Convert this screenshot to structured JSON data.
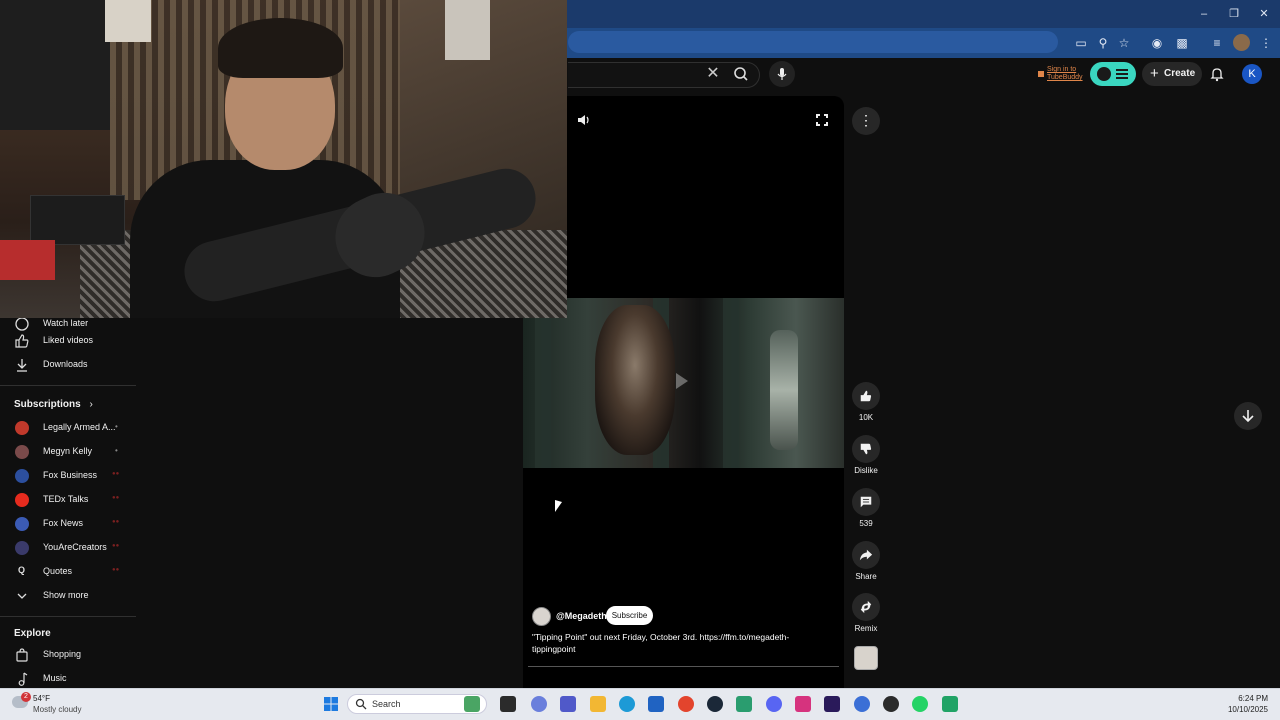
{
  "header": {
    "tubebuddy_label": "Sign in to TubeBuddy",
    "create_label": "Create",
    "avatar_letter": "K"
  },
  "sidebar": {
    "partial_item": "Watch later",
    "items": [
      {
        "label": "Liked videos",
        "icon": "thumbs-up-icon"
      },
      {
        "label": "Downloads",
        "icon": "download-icon"
      }
    ],
    "subscriptions_heading": "Subscriptions",
    "subscriptions": [
      {
        "label": "Legally Armed A...",
        "color": "#c0392b",
        "indicator": "dot"
      },
      {
        "label": "Megyn Kelly",
        "color": "#7a4a4a",
        "indicator": "dot"
      },
      {
        "label": "Fox Business",
        "color": "#2c4f9e",
        "indicator": "live"
      },
      {
        "label": "TEDx Talks",
        "color": "#e62b1e",
        "indicator": "live"
      },
      {
        "label": "Fox News",
        "color": "#3b5bb5",
        "indicator": "live"
      },
      {
        "label": "YouAreCreators",
        "color": "#3a3a6a",
        "indicator": "live"
      },
      {
        "label": "Quotes",
        "color": "#333333",
        "indicator": "live"
      }
    ],
    "show_more_label": "Show more",
    "explore_heading": "Explore",
    "explore_items": [
      {
        "label": "Shopping",
        "icon": "shopping-bag-icon"
      },
      {
        "label": "Music",
        "icon": "music-note-icon"
      }
    ]
  },
  "short": {
    "channel_handle": "@Megadeth",
    "subscribe_label": "Subscribe",
    "description": "\"Tipping Point\" out next Friday, October 3rd. https://ffm.to/megadeth-tippingpoint"
  },
  "actions": {
    "like_count": "10K",
    "dislike_label": "Dislike",
    "comment_count": "539",
    "share_label": "Share",
    "remix_label": "Remix"
  },
  "taskbar": {
    "weather_badge": "2",
    "temperature": "54°F",
    "condition": "Mostly cloudy",
    "search_label": "Search",
    "time": "6:24 PM",
    "date": "10/10/2025",
    "apps": [
      "file-explorer-icon",
      "copilot-icon",
      "teams-icon",
      "folder-icon",
      "edge-icon",
      "store-icon",
      "chrome-icon",
      "steam-icon",
      "app-icon",
      "discord-icon",
      "instagram-icon",
      "premiere-icon",
      "paint-icon",
      "media-player-icon",
      "whatsapp-icon",
      "sheets-icon"
    ]
  },
  "colors": {
    "accent_live": "#7a2020",
    "tubebuddy": "#3ad6c0",
    "youtube_bg": "#0f0f0f"
  }
}
